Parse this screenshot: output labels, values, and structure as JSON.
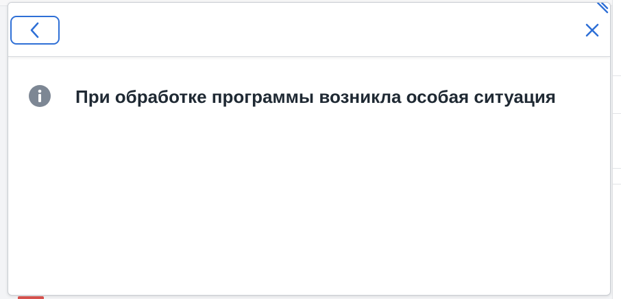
{
  "dialog": {
    "message": "При обработке программы возникла особая ситуация",
    "icons": {
      "back": "chevron-left-icon",
      "close": "close-icon",
      "info": "info-icon",
      "resize": "resize-grip-icon"
    }
  },
  "colors": {
    "accent": "#2e6fd6",
    "info_icon": "#7d8794",
    "text": "#1f2933",
    "border": "#c9cdd2"
  }
}
